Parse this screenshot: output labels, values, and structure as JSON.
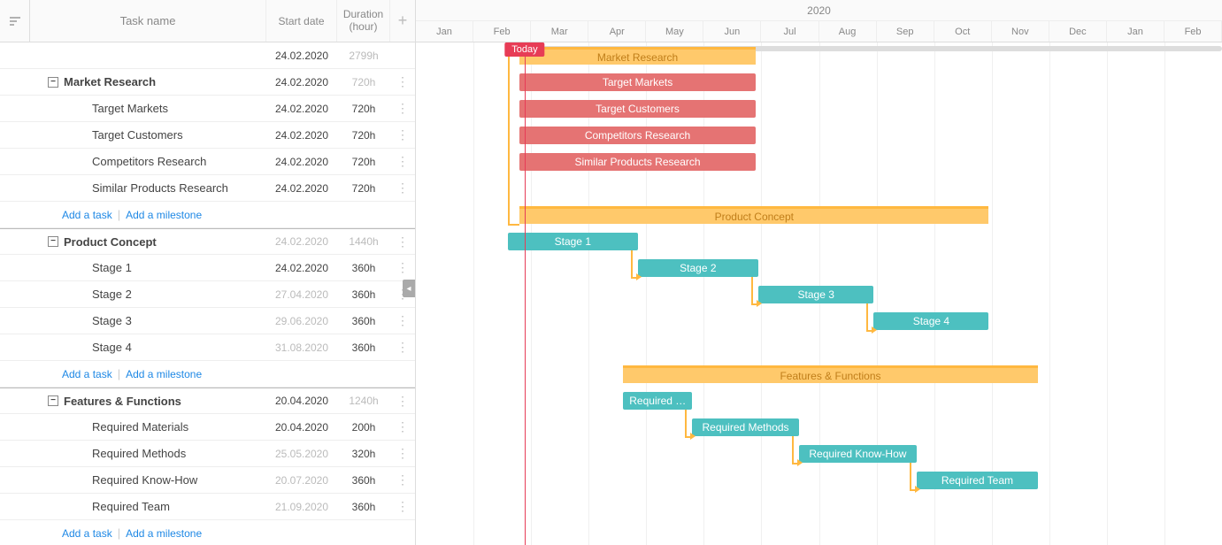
{
  "header": {
    "task_name": "Task name",
    "start_date": "Start date",
    "duration_l1": "Duration",
    "duration_l2": "(hour)"
  },
  "timeline": {
    "year": "2020",
    "months": [
      "Jan",
      "Feb",
      "Mar",
      "Apr",
      "May",
      "Jun",
      "Jul",
      "Aug",
      "Sep",
      "Oct",
      "Nov",
      "Dec",
      "Jan",
      "Feb"
    ],
    "today": "Today"
  },
  "summary": {
    "date": "24.02.2020",
    "dur": "2799h"
  },
  "groups": [
    {
      "name": "Market Research",
      "date": "24.02.2020",
      "dur": "720h",
      "muted": true,
      "tasks": [
        {
          "name": "Target Markets",
          "date": "24.02.2020",
          "dur": "720h"
        },
        {
          "name": "Target Customers",
          "date": "24.02.2020",
          "dur": "720h"
        },
        {
          "name": "Competitors Research",
          "date": "24.02.2020",
          "dur": "720h"
        },
        {
          "name": "Similar Products Research",
          "date": "24.02.2020",
          "dur": "720h"
        }
      ]
    },
    {
      "name": "Product Concept",
      "date": "24.02.2020",
      "dur": "1440h",
      "muted": true,
      "date_muted": true,
      "tasks": [
        {
          "name": "Stage 1",
          "date": "24.02.2020",
          "dur": "360h"
        },
        {
          "name": "Stage 2",
          "date": "27.04.2020",
          "dur": "360h",
          "date_muted": true
        },
        {
          "name": "Stage 3",
          "date": "29.06.2020",
          "dur": "360h",
          "date_muted": true
        },
        {
          "name": "Stage 4",
          "date": "31.08.2020",
          "dur": "360h",
          "date_muted": true
        }
      ]
    },
    {
      "name": "Features & Functions",
      "date": "20.04.2020",
      "dur": "1240h",
      "muted": true,
      "tasks": [
        {
          "name": "Required Materials",
          "date": "20.04.2020",
          "dur": "200h"
        },
        {
          "name": "Required Methods",
          "date": "25.05.2020",
          "dur": "320h",
          "date_muted": true
        },
        {
          "name": "Required Know-How",
          "date": "20.07.2020",
          "dur": "360h",
          "date_muted": true
        },
        {
          "name": "Required Team",
          "date": "21.09.2020",
          "dur": "360h",
          "date_muted": true
        }
      ]
    }
  ],
  "actions": {
    "add_task": "Add a task",
    "add_milestone": "Add a milestone"
  },
  "chart_data": {
    "type": "gantt",
    "unit": "month-index (0=Jan 2020)",
    "x_range": [
      0,
      14
    ],
    "today_x": 1.89,
    "summary": {
      "start": 1.8,
      "end": 14
    },
    "bars": [
      {
        "label": "Market Research",
        "type": "group",
        "row": 1,
        "start": 1.8,
        "end": 5.9
      },
      {
        "label": "Target Markets",
        "type": "task-red",
        "row": 2,
        "start": 1.8,
        "end": 5.9
      },
      {
        "label": "Target Customers",
        "type": "task-red",
        "row": 3,
        "start": 1.8,
        "end": 5.9
      },
      {
        "label": "Competitors Research",
        "type": "task-red",
        "row": 4,
        "start": 1.8,
        "end": 5.9
      },
      {
        "label": "Similar Products Research",
        "type": "task-red",
        "row": 5,
        "start": 1.8,
        "end": 5.9
      },
      {
        "label": "Product Concept",
        "type": "group",
        "row": 7,
        "start": 1.8,
        "end": 9.95
      },
      {
        "label": "Stage 1",
        "type": "task-teal",
        "row": 8,
        "start": 1.6,
        "end": 3.85
      },
      {
        "label": "Stage 2",
        "type": "task-teal",
        "row": 9,
        "start": 3.85,
        "end": 5.95
      },
      {
        "label": "Stage 3",
        "type": "task-teal",
        "row": 10,
        "start": 5.95,
        "end": 7.95
      },
      {
        "label": "Stage 4",
        "type": "task-teal",
        "row": 11,
        "start": 7.95,
        "end": 9.95
      },
      {
        "label": "Features & Functions",
        "type": "group",
        "row": 13,
        "start": 3.6,
        "end": 10.8
      },
      {
        "label": "Required …",
        "type": "task-teal",
        "row": 14,
        "start": 3.6,
        "end": 4.8,
        "full": "Required Materials"
      },
      {
        "label": "Required Methods",
        "type": "task-teal",
        "row": 15,
        "start": 4.8,
        "end": 6.65
      },
      {
        "label": "Required Know-How",
        "type": "task-teal",
        "row": 16,
        "start": 6.65,
        "end": 8.7
      },
      {
        "label": "Required Team",
        "type": "task-teal",
        "row": 17,
        "start": 8.7,
        "end": 10.8
      }
    ],
    "dependencies": [
      {
        "from_row": 1,
        "from_x": 1.6,
        "to_row": 7,
        "to_x": 1.8
      },
      {
        "from_row": 8,
        "to_row": 9
      },
      {
        "from_row": 9,
        "to_row": 10
      },
      {
        "from_row": 10,
        "to_row": 11
      },
      {
        "from_row": 14,
        "to_row": 15
      },
      {
        "from_row": 15,
        "to_row": 16
      },
      {
        "from_row": 16,
        "to_row": 17
      }
    ]
  }
}
